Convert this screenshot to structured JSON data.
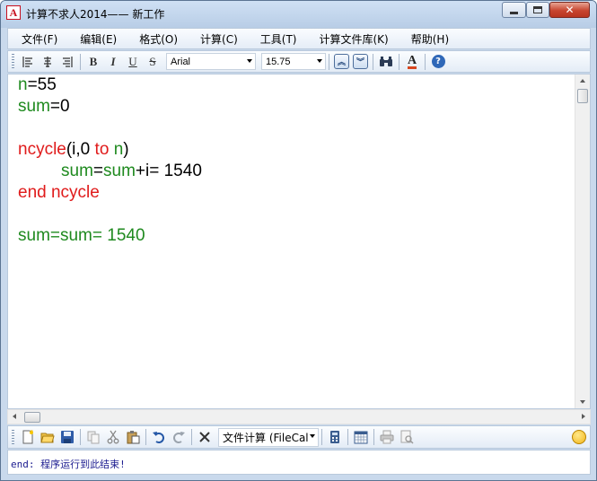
{
  "window": {
    "title": "计算不求人2014—— 新工作",
    "app_icon_glyph": "A",
    "close_glyph": "✕"
  },
  "menu": [
    {
      "label": "文件(F)"
    },
    {
      "label": "编辑(E)"
    },
    {
      "label": "格式(O)"
    },
    {
      "label": "计算(C)"
    },
    {
      "label": "工具(T)"
    },
    {
      "label": "计算文件库(K)"
    },
    {
      "label": "帮助(H)"
    }
  ],
  "format_toolbar": {
    "bold_glyph": "B",
    "italic_glyph": "I",
    "underline_glyph": "U",
    "strike_glyph": "S",
    "font_name": "Arial",
    "font_size": "15.75",
    "font_color_glyph": "A",
    "help_glyph": "?",
    "font_color_accent": "#d8461e"
  },
  "editor": {
    "colors": {
      "variable": "#1f8a1f",
      "keyword": "#e01b1b",
      "text": "#000000"
    },
    "lines": [
      [
        {
          "t": "n",
          "c": "g"
        },
        {
          "t": "=55",
          "c": "k"
        }
      ],
      [
        {
          "t": "sum",
          "c": "g"
        },
        {
          "t": "=0",
          "c": "k"
        }
      ],
      [],
      [
        {
          "t": "ncycle",
          "c": "r"
        },
        {
          "t": "(i,0 ",
          "c": "k"
        },
        {
          "t": "to",
          "c": "r"
        },
        {
          "t": " ",
          "c": "k"
        },
        {
          "t": "n",
          "c": "g"
        },
        {
          "t": ")",
          "c": "k"
        }
      ],
      [
        {
          "t": "sum",
          "c": "g"
        },
        {
          "t": "=",
          "c": "k"
        },
        {
          "t": "sum",
          "c": "g"
        },
        {
          "t": "+i= 1540",
          "c": "k"
        }
      ],
      [
        {
          "t": "end ncycle",
          "c": "r"
        }
      ],
      [],
      [
        {
          "t": "sum=sum= 1540",
          "c": "g"
        }
      ]
    ],
    "indented_lines": [
      4
    ]
  },
  "bottom_toolbar": {
    "calc_mode": "文件计算 (FileCal"
  },
  "status": {
    "message": "end: 程序运行到此结束!"
  }
}
